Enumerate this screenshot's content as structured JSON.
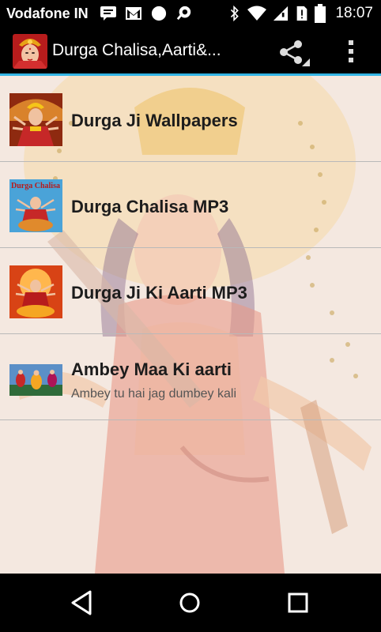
{
  "status_bar": {
    "carrier": "Vodafone IN",
    "time": "18:07",
    "icons": [
      "message-icon",
      "gmail-icon",
      "circle-notification-icon",
      "search-notification-icon",
      "bluetooth-icon",
      "wifi-icon",
      "no-sim-icon",
      "battery-icon"
    ]
  },
  "action_bar": {
    "title": "Durga Chalisa,Aarti&...",
    "icons": [
      "app-icon",
      "share-icon",
      "overflow-menu-icon"
    ]
  },
  "list": [
    {
      "label": "Durga Ji Wallpapers",
      "subtitle": ""
    },
    {
      "label": "Durga Chalisa MP3",
      "subtitle": "",
      "thumb_text": "Durga Chalisa"
    },
    {
      "label": "Durga Ji Ki Aarti MP3",
      "subtitle": ""
    },
    {
      "label": "Ambey Maa Ki aarti",
      "subtitle": "Ambey tu hai jag dumbey kali"
    }
  ],
  "nav_bar": {
    "icons": [
      "back-icon",
      "home-icon",
      "recents-icon"
    ]
  },
  "colors": {
    "accent": "#33b5e5",
    "bars": "#000000",
    "background": "#f3e6dc"
  }
}
